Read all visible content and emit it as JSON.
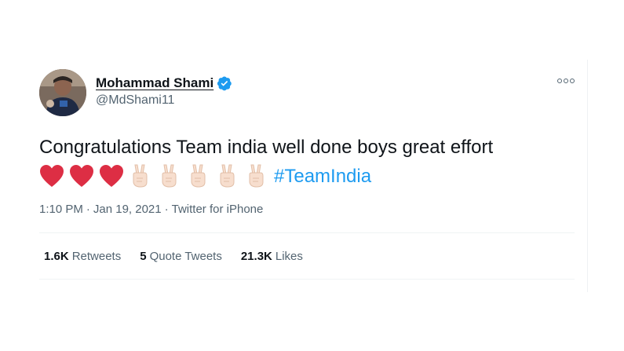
{
  "author": {
    "display_name": "Mohammad Shami",
    "handle": "@MdShami11",
    "verified_icon": "verified-badge-icon"
  },
  "more_icon": "more-options-icon",
  "tweet": {
    "text": "Congratulations Team india well done boys great effort",
    "emojis": [
      "red-heart-icon",
      "red-heart-icon",
      "red-heart-icon",
      "victory-hand-icon",
      "victory-hand-icon",
      "victory-hand-icon",
      "victory-hand-icon",
      "victory-hand-icon"
    ],
    "hashtag": "#TeamIndia"
  },
  "meta": {
    "time": "1:10 PM",
    "separator": "·",
    "date": "Jan 19, 2021",
    "source": "Twitter for iPhone"
  },
  "stats": {
    "retweets_count": "1.6K",
    "retweets_label": "Retweets",
    "quote_count": "5",
    "quote_label": "Quote Tweets",
    "likes_count": "21.3K",
    "likes_label": "Likes"
  },
  "colors": {
    "link_blue": "#1d9bf0",
    "verified_blue": "#1d9bf0",
    "heart_red": "#dd2e44",
    "secondary_text": "#536471"
  }
}
